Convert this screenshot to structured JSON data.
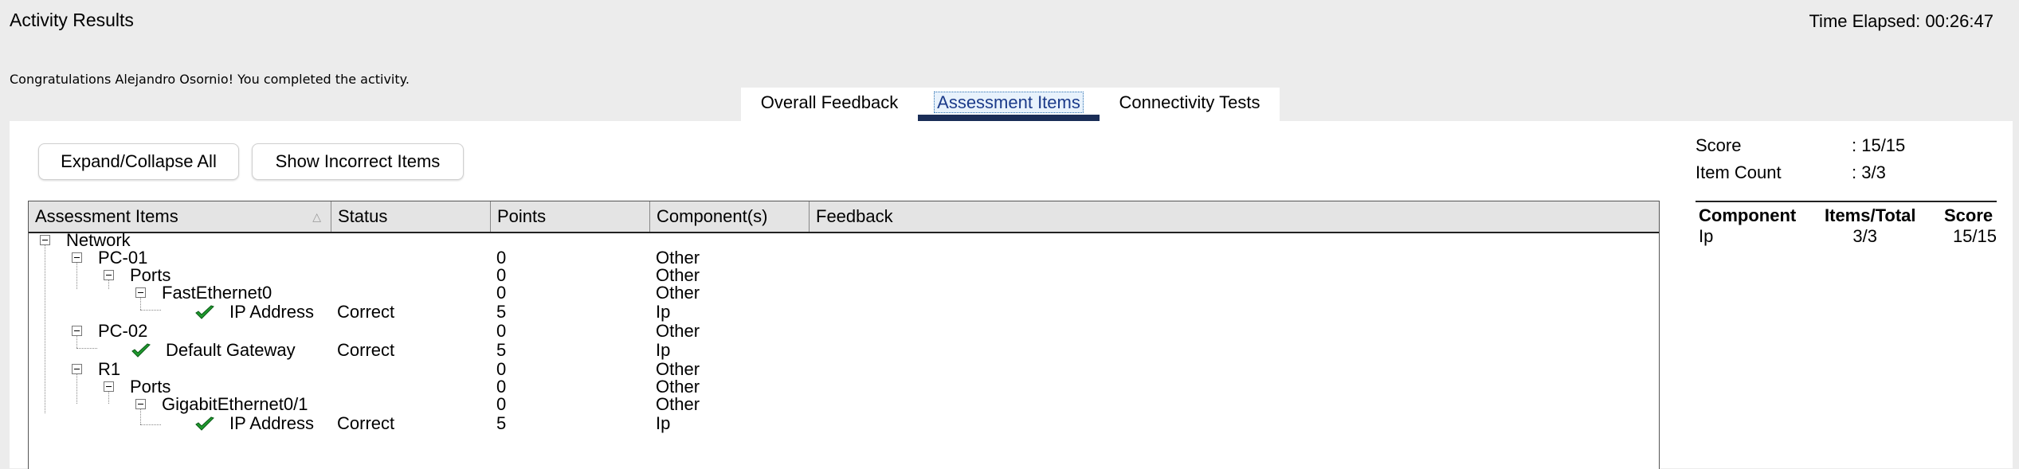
{
  "header": {
    "title": "Activity Results",
    "time_elapsed": "Time Elapsed: 00:26:47",
    "congrats": "Congratulations Alejandro Osornio! You completed the activity."
  },
  "tabs": [
    {
      "label": "Overall Feedback",
      "active": false
    },
    {
      "label": "Assessment Items",
      "active": true
    },
    {
      "label": "Connectivity Tests",
      "active": false
    }
  ],
  "toolbar": {
    "expand_label": "Expand/Collapse All",
    "show_incorrect_label": "Show Incorrect Items"
  },
  "table": {
    "columns": [
      "Assessment Items",
      "Status",
      "Points",
      "Component(s)",
      "Feedback"
    ],
    "rows": [
      {
        "label": "Network",
        "status": "",
        "points": "",
        "component": "",
        "toggle": true
      },
      {
        "label": "PC-01",
        "status": "",
        "points": "0",
        "component": "Other",
        "toggle": true
      },
      {
        "label": "Ports",
        "status": "",
        "points": "0",
        "component": "Other",
        "toggle": true
      },
      {
        "label": "FastEthernet0",
        "status": "",
        "points": "0",
        "component": "Other",
        "toggle": true
      },
      {
        "label": "IP Address",
        "status": "Correct",
        "points": "5",
        "component": "Ip",
        "check": true
      },
      {
        "label": "PC-02",
        "status": "",
        "points": "0",
        "component": "Other",
        "toggle": true
      },
      {
        "label": "Default Gateway",
        "status": "Correct",
        "points": "5",
        "component": "Ip",
        "check": true
      },
      {
        "label": "R1",
        "status": "",
        "points": "0",
        "component": "Other",
        "toggle": true
      },
      {
        "label": "Ports",
        "status": "",
        "points": "0",
        "component": "Other",
        "toggle": true
      },
      {
        "label": "GigabitEthernet0/1",
        "status": "",
        "points": "0",
        "component": "Other",
        "toggle": true
      },
      {
        "label": "IP Address",
        "status": "Correct",
        "points": "5",
        "component": "Ip",
        "check": true
      }
    ]
  },
  "summary": {
    "score_label": "Score",
    "score_value": ": 15/15",
    "item_count_label": "Item Count",
    "item_count_value": ": 3/3",
    "columns": [
      "Component",
      "Items/Total",
      "Score"
    ],
    "rows": [
      {
        "component": "Ip",
        "items_total": "3/3",
        "score": "15/15"
      }
    ]
  },
  "colors": {
    "active_tab_underline": "#1a2d57",
    "check_green": "#1f9a2e",
    "background": "#ececec"
  },
  "icons": {
    "toggle": "collapse-box-icon",
    "check": "checkmark-icon",
    "sort": "sort-arrow-icon"
  }
}
